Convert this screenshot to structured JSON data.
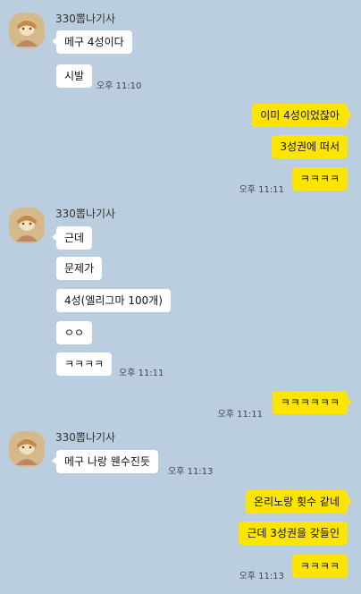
{
  "chat": {
    "sender_name": "330뽑나기사",
    "groups": [
      {
        "side": "in",
        "messages": [
          "메구 4성이다",
          "시발"
        ],
        "time": "오후 11:10"
      },
      {
        "side": "out",
        "messages": [
          "이미 4성이었잖아",
          "3성권에 떠서",
          "ㅋㅋㅋㅋ"
        ],
        "time": "오후 11:11"
      },
      {
        "side": "in",
        "messages": [
          "근데",
          "문제가",
          "4성(엘리그마 100개)",
          "ㅇㅇ",
          "ㅋㅋㅋㅋ"
        ],
        "time": "오후 11:11"
      },
      {
        "side": "out",
        "messages": [
          "ㅋㅋㅋㅋㅋㅋ"
        ],
        "time": "오후 11:11"
      },
      {
        "side": "in",
        "messages": [
          "메구 나랑 웬수진듯"
        ],
        "time": "오후 11:13"
      },
      {
        "side": "out",
        "messages": [
          "온리노랑 횟수 같네",
          "근데 3성권을 갖들인",
          "ㅋㅋㅋㅋ"
        ],
        "time": "오후 11:13"
      }
    ]
  },
  "colors": {
    "background": "#bacee0",
    "incoming_bubble": "#ffffff",
    "outgoing_bubble": "#fee500"
  },
  "icons": {
    "avatar": "profile-avatar-icon"
  }
}
